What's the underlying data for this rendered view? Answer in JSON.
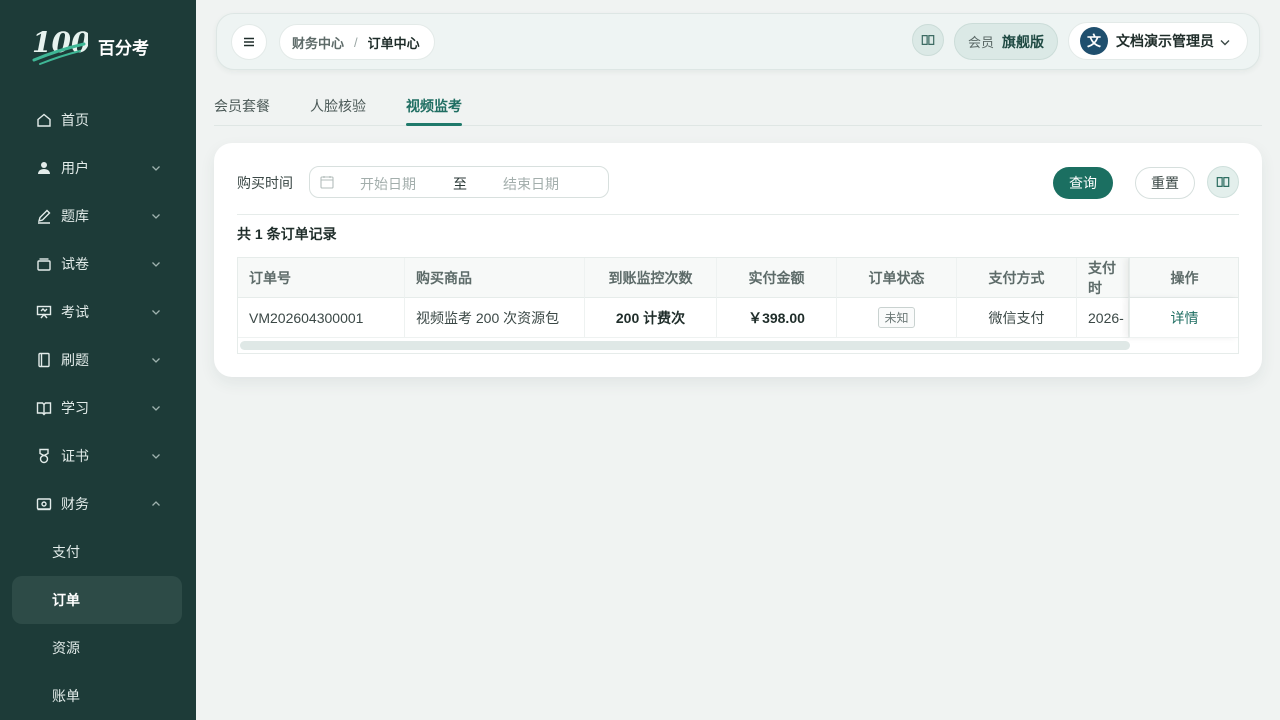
{
  "brand": {
    "logo_text": "100",
    "name": "百分考"
  },
  "sidebar": {
    "items": [
      {
        "label": "首页",
        "icon": "home-icon",
        "has_chevron": false
      },
      {
        "label": "用户",
        "icon": "user-icon",
        "has_chevron": true
      },
      {
        "label": "题库",
        "icon": "edit-icon",
        "has_chevron": true
      },
      {
        "label": "试卷",
        "icon": "layers-icon",
        "has_chevron": true
      },
      {
        "label": "考试",
        "icon": "presentation-icon",
        "has_chevron": true
      },
      {
        "label": "刷题",
        "icon": "notebook-icon",
        "has_chevron": true
      },
      {
        "label": "学习",
        "icon": "book-icon",
        "has_chevron": true
      },
      {
        "label": "证书",
        "icon": "medal-icon",
        "has_chevron": true
      },
      {
        "label": "财务",
        "icon": "wallet-icon",
        "has_chevron": true,
        "expanded": true
      }
    ],
    "sub_items": [
      {
        "label": "支付"
      },
      {
        "label": "订单",
        "active": true
      },
      {
        "label": "资源"
      },
      {
        "label": "账单"
      }
    ]
  },
  "header": {
    "breadcrumb": {
      "parent": "财务中心",
      "separator": "/",
      "current": "订单中心"
    },
    "member_label": "会员",
    "member_level": "旗舰版",
    "avatar_text": "文",
    "user_name": "文档演示管理员"
  },
  "tabs": [
    {
      "label": "会员套餐",
      "active": false
    },
    {
      "label": "人脸核验",
      "active": false
    },
    {
      "label": "视频监考",
      "active": true
    }
  ],
  "filter": {
    "label": "购买时间",
    "start_placeholder": "开始日期",
    "range_separator": "至",
    "end_placeholder": "结束日期",
    "query_label": "查询",
    "reset_label": "重置"
  },
  "summary": "共 1 条订单记录",
  "table": {
    "columns": [
      "订单号",
      "购买商品",
      "到账监控次数",
      "实付金额",
      "订单状态",
      "支付方式",
      "支付时",
      "操作"
    ],
    "rows": [
      {
        "order_no": "VM202604300001",
        "product": "视频监考 200 次资源包",
        "count": "200 计费次",
        "amount": "￥398.00",
        "status": "未知",
        "pay_method": "微信支付",
        "pay_time": "2026-",
        "action": "详情"
      }
    ]
  },
  "colors": {
    "sidebar_bg": "#1d3b38",
    "accent": "#1b6f61",
    "page_bg": "#f0f3f2"
  }
}
